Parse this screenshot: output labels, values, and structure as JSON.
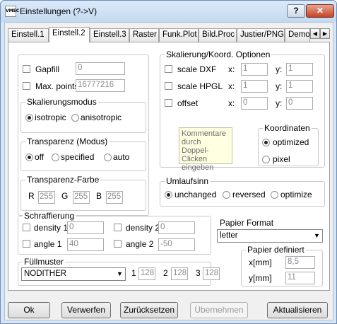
{
  "window": {
    "title": "Einstellungen (?->V)",
    "app_icon_text": "VMEC",
    "help_label": "?",
    "close_label": "✕"
  },
  "tabs": [
    "Einstell.1",
    "Einstell.2",
    "Einstell.3",
    "Raster",
    "Funk.Plot",
    "Bild.Proc",
    "Justier/PNG",
    "Demo"
  ],
  "tab_scroll": {
    "left": "◀",
    "right": "▶"
  },
  "gapfill": {
    "label": "Gapfill",
    "value": "0"
  },
  "max_points": {
    "label": "Max. points",
    "value": "16777216"
  },
  "skalierungsmodus": {
    "title": "Skalierungsmodus",
    "isotropic": "isotropic",
    "anisotropic": "anisotropic"
  },
  "transparenz_modus": {
    "title": "Transparenz (Modus)",
    "off": "off",
    "specified": "specified",
    "auto": "auto"
  },
  "transparenz_farbe": {
    "title": "Transparenz-Farbe",
    "r_label": "R",
    "r": "255",
    "g_label": "G",
    "g": "255",
    "b_label": "B",
    "b": "255"
  },
  "skalierung": {
    "title": "Skalierung/Koord. Optionen",
    "x_label": "x:",
    "y_label": "y:",
    "rows": [
      {
        "label": "scale DXF",
        "x": "1",
        "y": "1"
      },
      {
        "label": "scale HPGL",
        "x": "1",
        "y": "1"
      },
      {
        "label": "offset",
        "x": "0",
        "y": "0"
      }
    ],
    "comment": "Kommentare durch Doppel-Clicken eingeben"
  },
  "koordinaten": {
    "title": "Koordinaten",
    "optimized": "optimized",
    "pixel": "pixel"
  },
  "umlaufsinn": {
    "title": "Umlaufsinn",
    "unchanged": "unchanged",
    "reversed": "reversed",
    "optimize": "optimize"
  },
  "schraffierung": {
    "title": "Schraffierung",
    "density1": {
      "label": "density 1",
      "value": "0"
    },
    "density2": {
      "label": "density 2",
      "value": "0"
    },
    "angle1": {
      "label": "angle 1",
      "value": "40"
    },
    "angle2": {
      "label": "angle 2",
      "value": "-50"
    }
  },
  "papier_format": {
    "label": "Papier Format",
    "value": "letter"
  },
  "fuellmuster": {
    "title": "Füllmuster",
    "value": "NODITHER",
    "n1": "1",
    "v1": "128",
    "n2": "2",
    "v2": "128",
    "n3": "3",
    "v3": "128"
  },
  "papier_definiert": {
    "title": "Papier definiert",
    "x_label": "x[mm]",
    "x": "8,5",
    "y_label": "y[mm]",
    "y": "11"
  },
  "buttons": {
    "ok": "Ok",
    "verwerfen": "Verwerfen",
    "zuruecksetzen": "Zurücksetzen",
    "uebernehmen": "Übernehmen",
    "aktualisieren": "Aktualisieren"
  }
}
